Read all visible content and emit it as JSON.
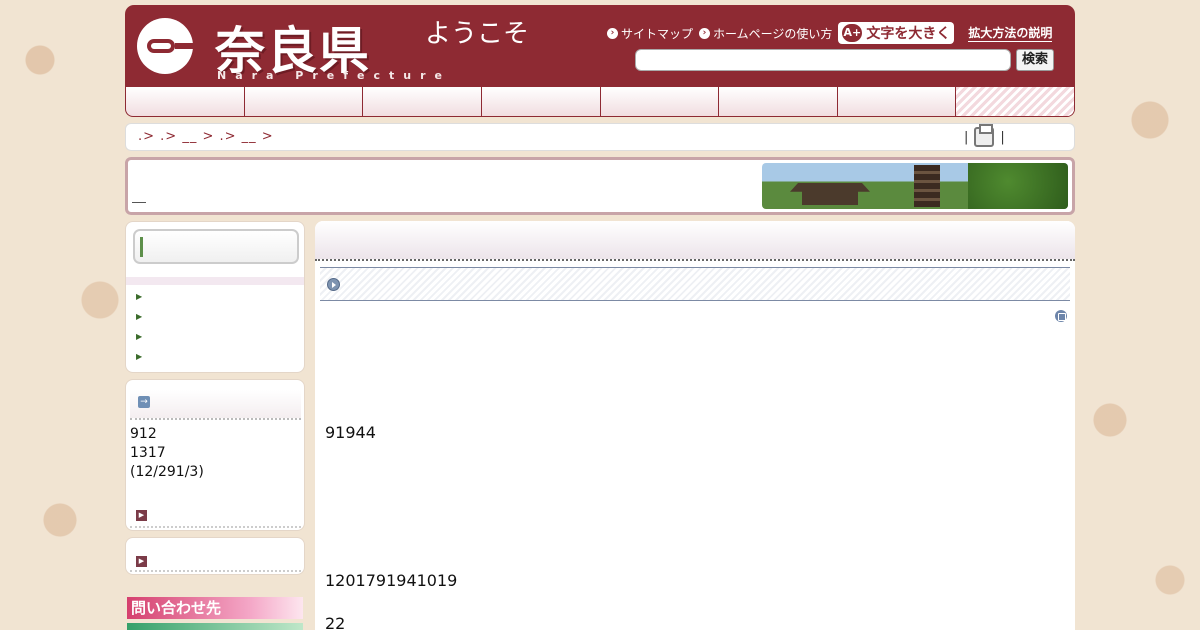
{
  "header": {
    "logo_text": "奈良県",
    "logo_sub": "Nara Prefecture",
    "welcome": "ようこそ",
    "links": [
      {
        "label": "サイトマップ",
        "icon": "arrow-right-circle-icon"
      },
      {
        "label": "ホームページの使い方",
        "icon": "arrow-right-circle-icon"
      }
    ],
    "enlarge_label": "文字を大きく",
    "enlarge_icon_text": "A+",
    "explain_label": "拡大方法の説明",
    "search_value": "",
    "search_button": "検索"
  },
  "nav": {
    "items": [
      "",
      "",
      "",
      "",
      "",
      "",
      "",
      ""
    ]
  },
  "breadcrumb": {
    "path": ".> .> __ > .> __ >",
    "print_sep_left": "|",
    "print_sep_right": "|"
  },
  "banner": {
    "title": ""
  },
  "sidebar": {
    "search_value": "",
    "menu_items": [
      "",
      "",
      "",
      ""
    ],
    "info": {
      "lines": [
        "912",
        "1317",
        "(12/291/3)"
      ]
    },
    "contact_label": "問い合わせ先"
  },
  "main": {
    "title": "",
    "section_title": "",
    "paragraphs": [
      "91944",
      "1201791941019",
      "22"
    ]
  }
}
